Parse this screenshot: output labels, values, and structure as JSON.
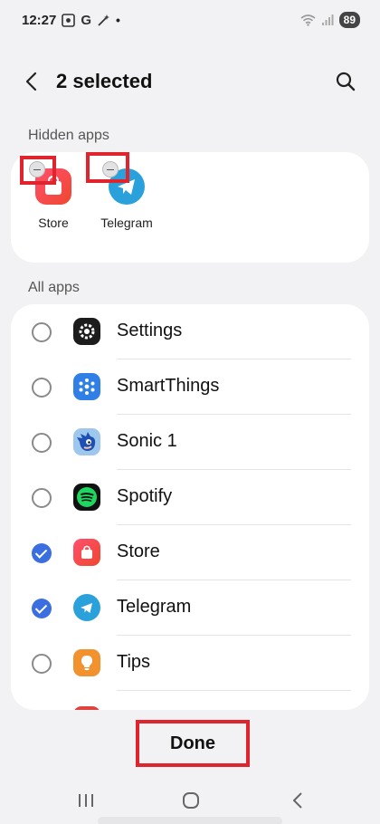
{
  "status_bar": {
    "time": "12:27",
    "left_icons": [
      "screenshot-icon",
      "google-icon",
      "magic-wand-icon",
      "dot-icon"
    ],
    "right_icons": [
      "wifi-icon",
      "signal-icon"
    ],
    "battery": "89"
  },
  "header": {
    "title": "2 selected"
  },
  "hidden_section": {
    "label": "Hidden apps",
    "apps": [
      {
        "name": "Store",
        "icon": "store-icon"
      },
      {
        "name": "Telegram",
        "icon": "telegram-icon"
      }
    ]
  },
  "all_section": {
    "label": "All apps",
    "apps": [
      {
        "name": "Settings",
        "checked": false,
        "icon": "settings-icon"
      },
      {
        "name": "SmartThings",
        "checked": false,
        "icon": "smartthings-icon"
      },
      {
        "name": "Sonic 1",
        "checked": false,
        "icon": "sonic-icon"
      },
      {
        "name": "Spotify",
        "checked": false,
        "icon": "spotify-icon"
      },
      {
        "name": "Store",
        "checked": true,
        "icon": "store-icon"
      },
      {
        "name": "Telegram",
        "checked": true,
        "icon": "telegram-icon"
      },
      {
        "name": "Tips",
        "checked": false,
        "icon": "tips-icon"
      }
    ]
  },
  "done_label": "Done",
  "navbar": {
    "items": [
      "recents-icon",
      "home-icon",
      "back-icon"
    ]
  },
  "colors": {
    "accent": "#3b6fe0",
    "highlight": "#e0242e",
    "background": "#f2f2f4"
  }
}
